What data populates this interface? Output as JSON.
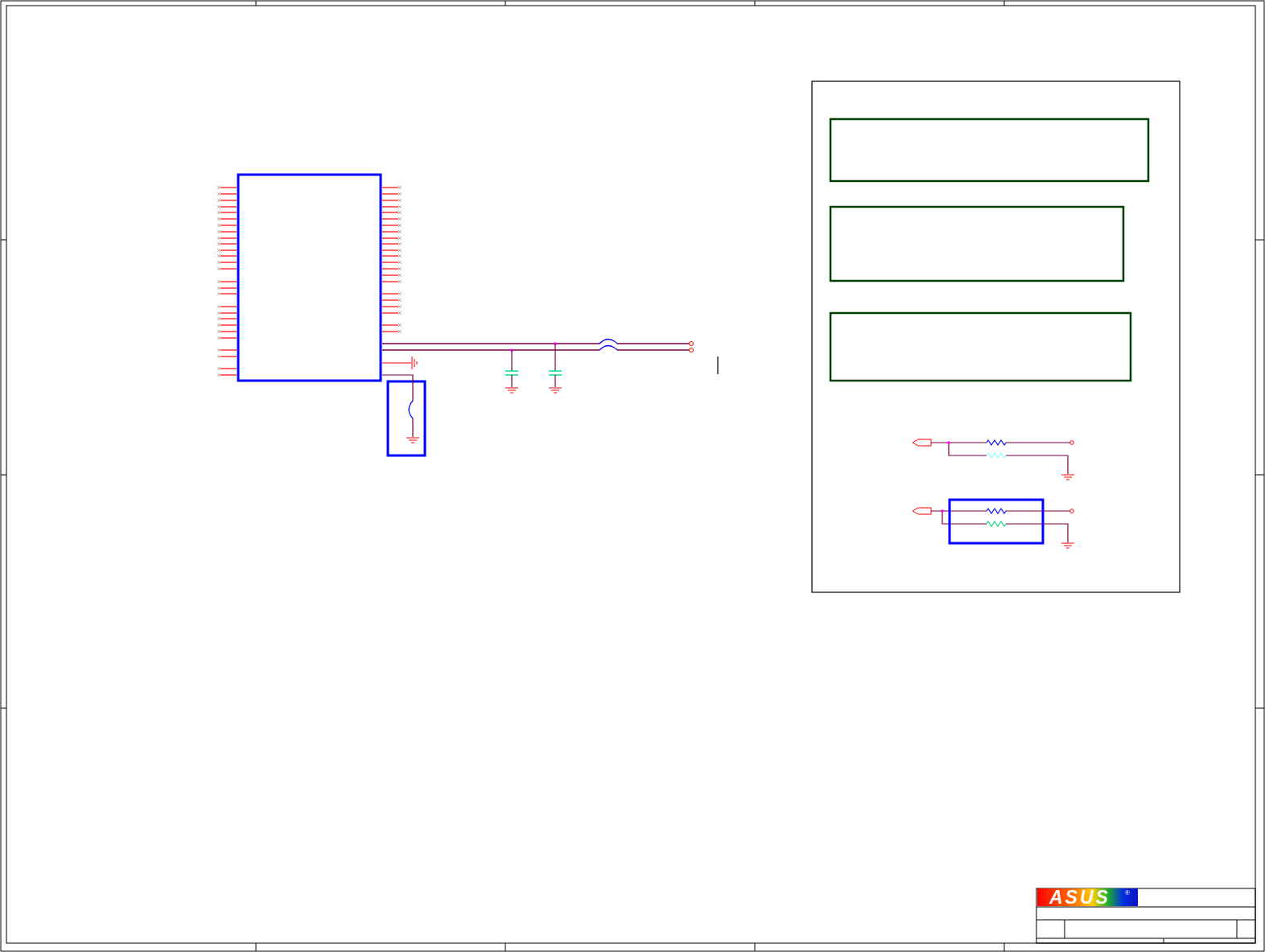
{
  "title_block": {
    "logo": {
      "text": "ASUS",
      "mark": "®"
    }
  }
}
